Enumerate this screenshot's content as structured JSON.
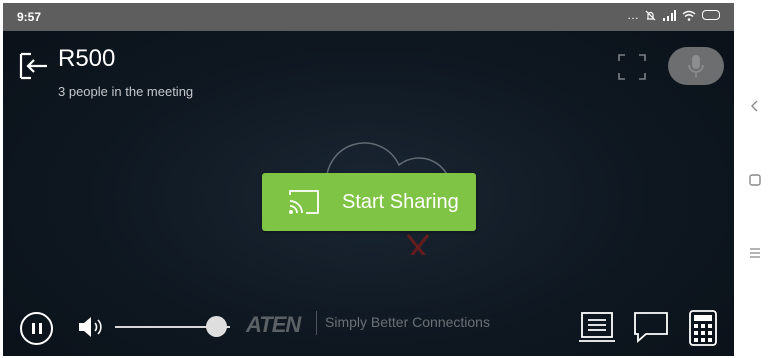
{
  "status_bar": {
    "time": "9:57",
    "indicators": [
      "more-dots-icon",
      "mute-icon",
      "signal-icon",
      "wifi-icon",
      "battery-icon"
    ]
  },
  "header": {
    "title": "R500",
    "subtitle": "3 people in the meeting",
    "back_icon": "exit-arrow-icon",
    "fullscreen_icon": "fullscreen-icon",
    "mic_icon": "microphone-icon"
  },
  "main": {
    "background_graphic": "cloud-disconnected-icon",
    "share_button": {
      "label": "Start Sharing",
      "icon": "cast-icon",
      "color": "#80c446"
    }
  },
  "bottom_bar": {
    "pause_icon": "pause-icon",
    "volume_icon": "volume-icon",
    "volume_level": 0.88,
    "brand": "ATEN",
    "tagline": "Simply Better Connections",
    "tools": [
      "notes-icon",
      "chat-icon",
      "keypad-icon"
    ]
  },
  "nav_bar": {
    "buttons": [
      "back-icon",
      "home-icon",
      "menu-icon"
    ]
  },
  "colors": {
    "accent": "#80c446",
    "background": "#0e1720",
    "status_bar": "#5e5e5e"
  }
}
